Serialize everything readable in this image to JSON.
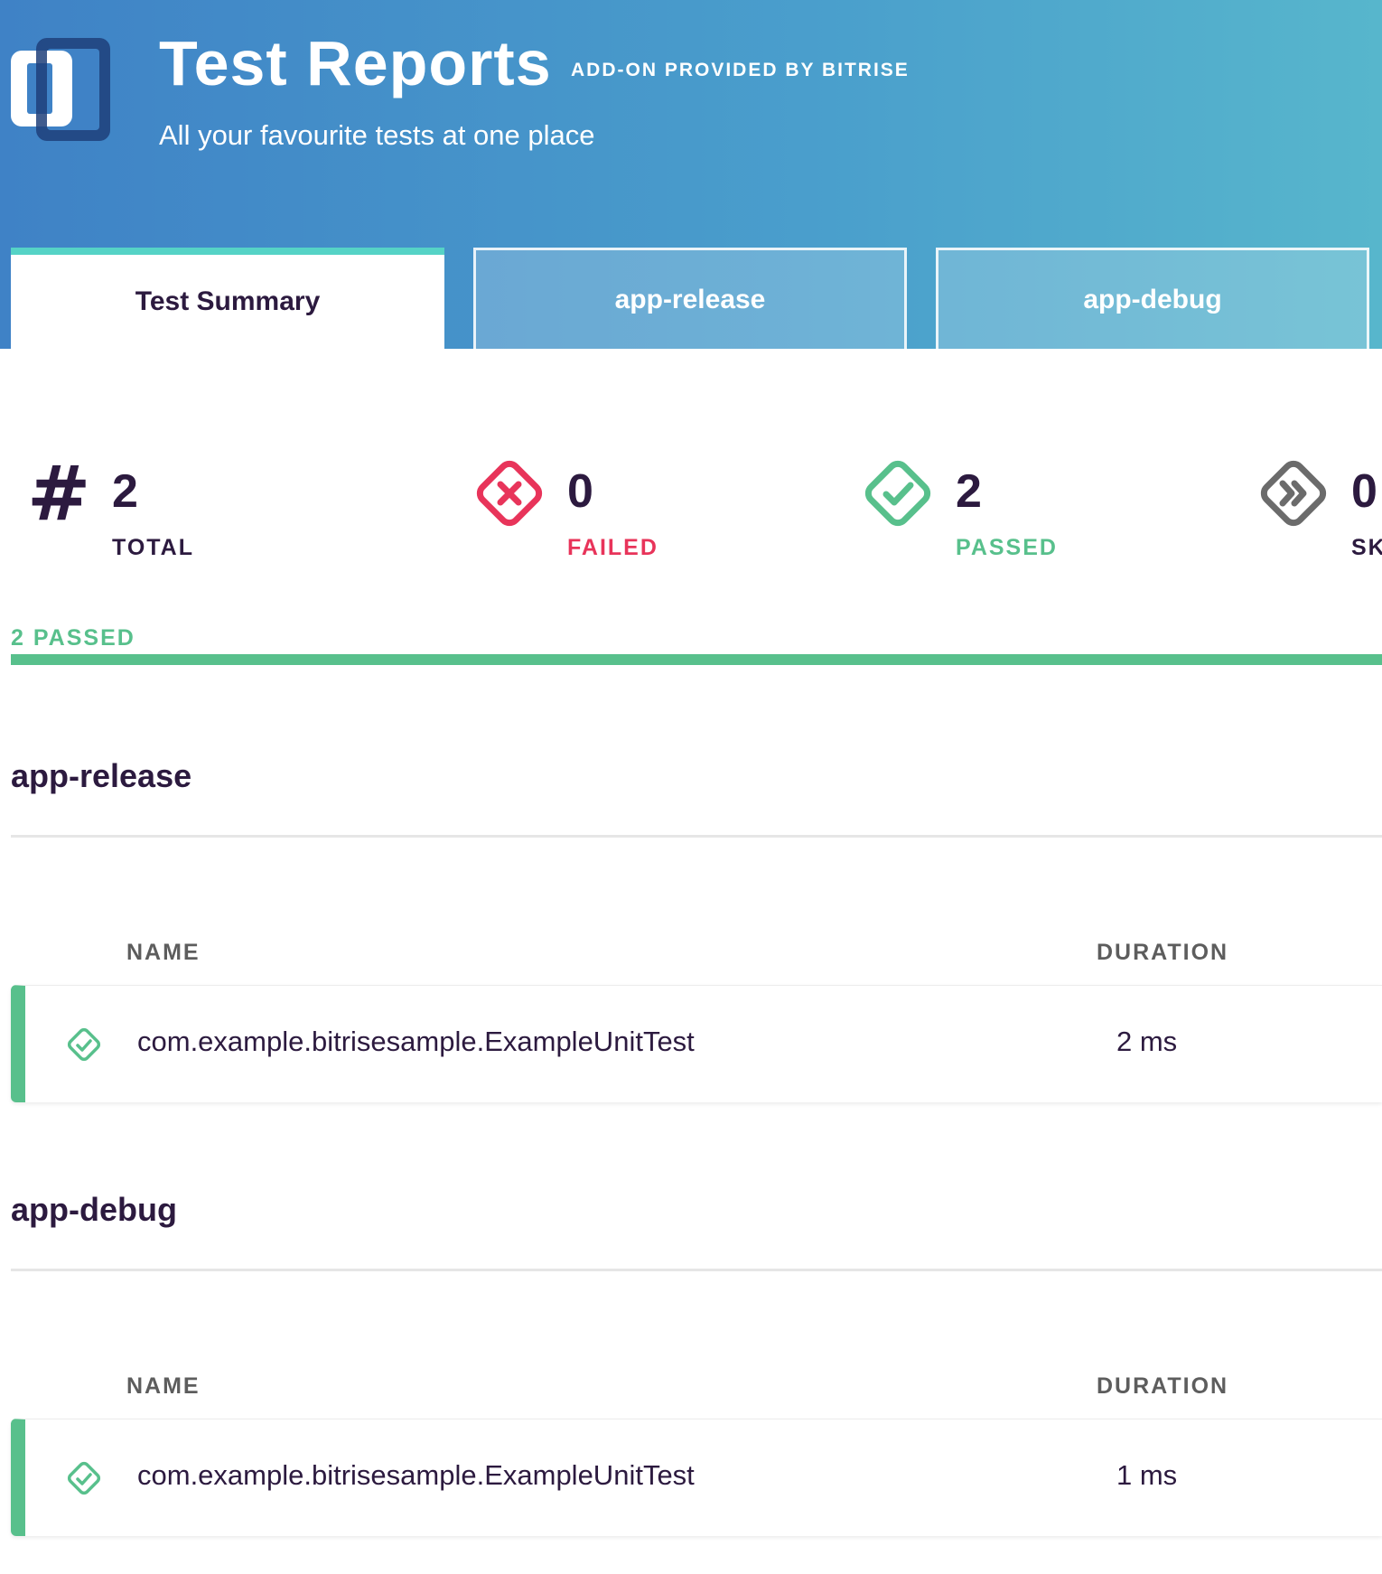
{
  "header": {
    "title": "Test Reports",
    "addon_label": "ADD-ON PROVIDED BY BITRISE",
    "tagline": "All your favourite tests at one place"
  },
  "tabs": [
    {
      "label": "Test Summary",
      "active": true
    },
    {
      "label": "app-release",
      "active": false
    },
    {
      "label": "app-debug",
      "active": false
    }
  ],
  "stats": {
    "total": {
      "value": "2",
      "label": "TOTAL",
      "icon": "hash-icon"
    },
    "failed": {
      "value": "0",
      "label": "FAILED",
      "icon": "failed-x-icon",
      "color": "#e8345a"
    },
    "passed": {
      "value": "2",
      "label": "PASSED",
      "icon": "passed-check-icon",
      "color": "#58c08c"
    },
    "skipped": {
      "value": "0",
      "label": "SK",
      "icon": "skipped-chevrons-icon",
      "color": "#6b6b6b"
    }
  },
  "progress": {
    "label": "2 PASSED",
    "passed_fraction": 1.0,
    "color": "#58c08c"
  },
  "sections": [
    {
      "title": "app-release",
      "columns": {
        "name": "NAME",
        "duration": "DURATION"
      },
      "rows": [
        {
          "name": "com.example.bitrisesample.ExampleUnitTest",
          "duration": "2 ms",
          "status": "passed"
        }
      ]
    },
    {
      "title": "app-debug",
      "columns": {
        "name": "NAME",
        "duration": "DURATION"
      },
      "rows": [
        {
          "name": "com.example.bitrisesample.ExampleUnitTest",
          "duration": "1 ms",
          "status": "passed"
        }
      ]
    }
  ],
  "colors": {
    "accent_teal": "#55d3c6",
    "text_dark": "#2c1a3f",
    "passed_green": "#58c08c",
    "failed_red": "#e8345a"
  }
}
